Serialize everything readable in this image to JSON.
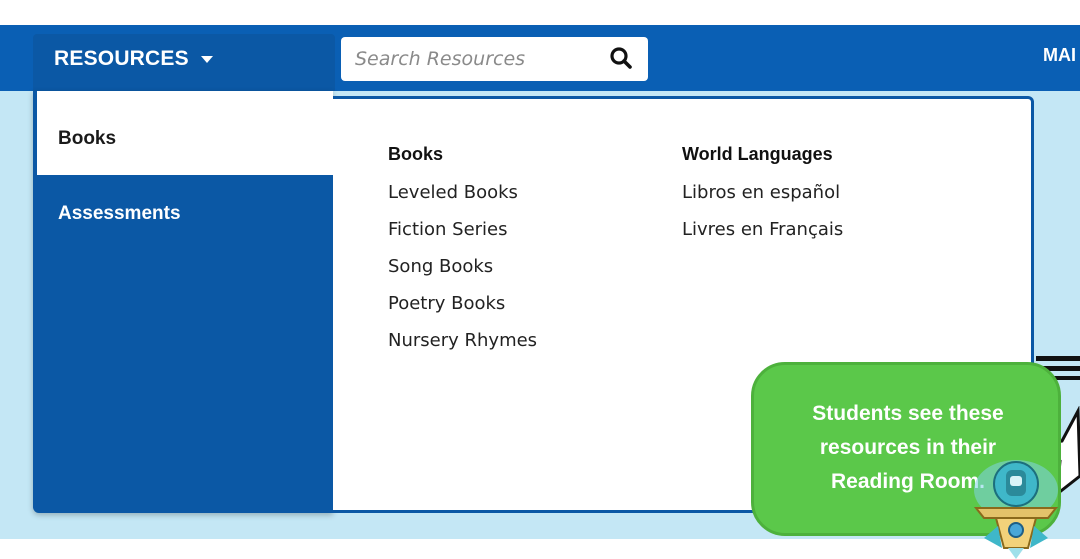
{
  "nav": {
    "resources_label": "RESOURCES",
    "search_placeholder": "Search Resources",
    "right_item": "MAI"
  },
  "menu": {
    "side_items": [
      {
        "label": "Books"
      },
      {
        "label": "Assessments"
      }
    ],
    "columns": [
      {
        "heading": "Books",
        "links": [
          "Leveled Books",
          "Fiction Series",
          "Song Books",
          "Poetry Books",
          "Nursery Rhymes"
        ]
      },
      {
        "heading": "World Languages",
        "links": [
          "Libros en español",
          "Livres en Français"
        ]
      }
    ]
  },
  "callout": {
    "line1": "Students see these",
    "line2": "resources in their",
    "line3": "Reading Room."
  },
  "icons": {
    "caret": "caret-down-icon",
    "search": "search-icon",
    "mascot": "robot-mascot-icon"
  },
  "colors": {
    "nav_blue": "#0a5fb4",
    "menu_blue": "#0b58a5",
    "hero_light_blue": "#c4e7f5",
    "callout_green": "#5bc84a"
  }
}
